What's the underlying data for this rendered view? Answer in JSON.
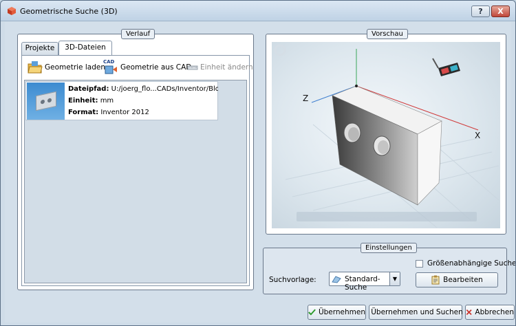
{
  "window": {
    "title": "Geometrische Suche (3D)",
    "help_label": "?",
    "close_label": "X"
  },
  "verlauf": {
    "label": "Verlauf",
    "tabs": [
      {
        "label": "Projekte",
        "active": false
      },
      {
        "label": "3D-Dateien",
        "active": true
      }
    ],
    "toolbar": {
      "load_label": "Geometrie laden",
      "from_cad_label": "Geometrie aus CAD",
      "cad_badge": "CAD",
      "unit_label": "Einheit ändern"
    },
    "file": {
      "path_key": "Dateipfad:",
      "path_value": "U:/joerg_flo...CADs/Inventor/Block.ipt",
      "unit_key": "Einheit:",
      "unit_value": "mm",
      "format_key": "Format:",
      "format_value": "Inventor 2012"
    }
  },
  "vorschau": {
    "label": "Vorschau",
    "axis_z": "Z",
    "axis_x": "X"
  },
  "einstellungen": {
    "label": "Einstellungen",
    "size_dependent_label": "Größenabhängige Suche",
    "size_dependent_checked": false,
    "template_label": "Suchvorlage:",
    "template_value": "Standard-Suche",
    "edit_label": "Bearbeiten"
  },
  "footer": {
    "apply_label": "Übernehmen",
    "apply_search_label": "Übernehmen und Suchen",
    "cancel_label": "Abbrechen"
  },
  "colors": {
    "accent_green": "#2e9b2e",
    "cancel_red": "#c8312a"
  }
}
